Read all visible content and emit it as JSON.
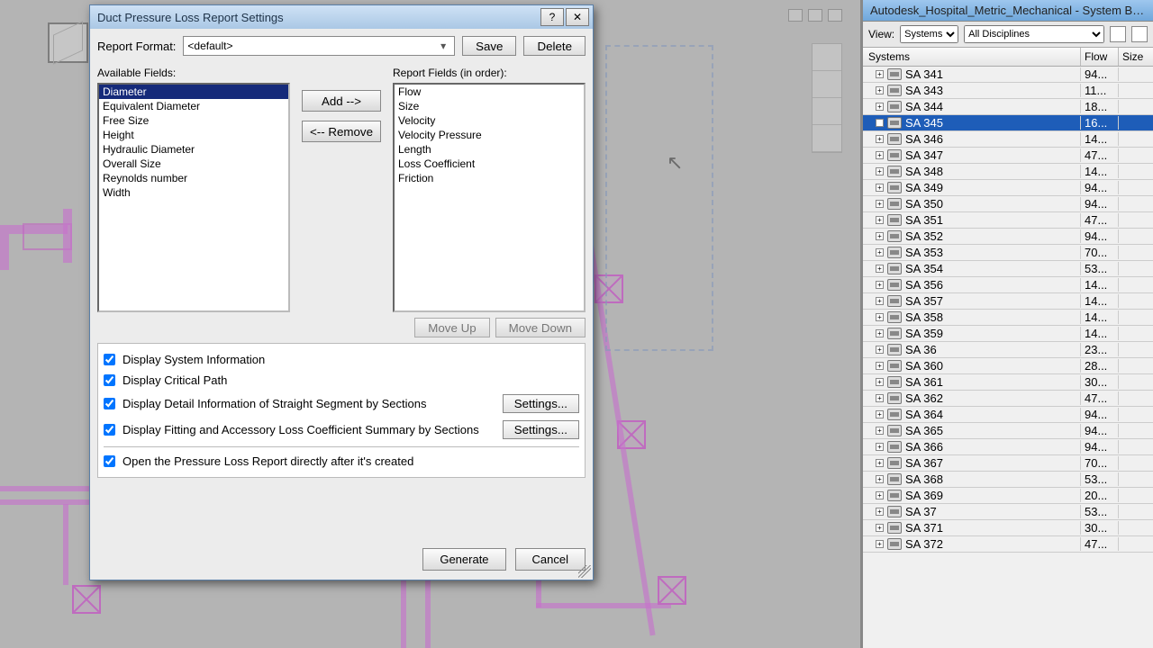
{
  "dialog": {
    "title": "Duct Pressure Loss Report Settings",
    "help_tooltip": "?",
    "close_tooltip": "✕",
    "report_format_label": "Report Format:",
    "report_format_value": "<default>",
    "save_label": "Save",
    "delete_label": "Delete",
    "available_fields_label": "Available Fields:",
    "report_fields_label": "Report Fields (in order):",
    "add_label": "Add -->",
    "remove_label": "<-- Remove",
    "move_up_label": "Move Up",
    "move_down_label": "Move Down",
    "available_fields": [
      "Diameter",
      "Equivalent Diameter",
      "Free Size",
      "Height",
      "Hydraulic Diameter",
      "Overall Size",
      "Reynolds number",
      "Width"
    ],
    "available_selected_index": 0,
    "report_fields": [
      "Flow",
      "Size",
      "Velocity",
      "Velocity Pressure",
      "Length",
      "Loss Coefficient",
      "Friction"
    ],
    "options": {
      "display_system_info": "Display System Information",
      "display_critical_path": "Display Critical Path",
      "display_straight_segments": "Display Detail Information of Straight Segment by Sections",
      "display_fitting_summary": "Display Fitting and Accessory Loss Coefficient Summary by Sections",
      "open_after_create": "Open the Pressure Loss Report directly after it's created",
      "settings_label": "Settings..."
    },
    "generate_label": "Generate",
    "cancel_label": "Cancel"
  },
  "system_browser": {
    "title": "Autodesk_Hospital_Metric_Mechanical - System B…",
    "view_label": "View:",
    "view_value": "Systems",
    "discipline_value": "All Disciplines",
    "columns": {
      "c1": "Systems",
      "c2": "Flow",
      "c3": "Size"
    },
    "selected_index": 3,
    "rows": [
      {
        "name": "SA 341",
        "flow": "94..."
      },
      {
        "name": "SA 343",
        "flow": "11..."
      },
      {
        "name": "SA 344",
        "flow": "18..."
      },
      {
        "name": "SA 345",
        "flow": "16..."
      },
      {
        "name": "SA 346",
        "flow": "14..."
      },
      {
        "name": "SA 347",
        "flow": "47..."
      },
      {
        "name": "SA 348",
        "flow": "14..."
      },
      {
        "name": "SA 349",
        "flow": "94..."
      },
      {
        "name": "SA 350",
        "flow": "94..."
      },
      {
        "name": "SA 351",
        "flow": "47..."
      },
      {
        "name": "SA 352",
        "flow": "94..."
      },
      {
        "name": "SA 353",
        "flow": "70..."
      },
      {
        "name": "SA 354",
        "flow": "53..."
      },
      {
        "name": "SA 356",
        "flow": "14..."
      },
      {
        "name": "SA 357",
        "flow": "14..."
      },
      {
        "name": "SA 358",
        "flow": "14..."
      },
      {
        "name": "SA 359",
        "flow": "14..."
      },
      {
        "name": "SA 36",
        "flow": "23..."
      },
      {
        "name": "SA 360",
        "flow": "28..."
      },
      {
        "name": "SA 361",
        "flow": "30..."
      },
      {
        "name": "SA 362",
        "flow": "47..."
      },
      {
        "name": "SA 364",
        "flow": "94..."
      },
      {
        "name": "SA 365",
        "flow": "94..."
      },
      {
        "name": "SA 366",
        "flow": "94..."
      },
      {
        "name": "SA 367",
        "flow": "70..."
      },
      {
        "name": "SA 368",
        "flow": "53..."
      },
      {
        "name": "SA 369",
        "flow": "20..."
      },
      {
        "name": "SA 37",
        "flow": "53..."
      },
      {
        "name": "SA 371",
        "flow": "30..."
      },
      {
        "name": "SA 372",
        "flow": "47..."
      }
    ]
  }
}
